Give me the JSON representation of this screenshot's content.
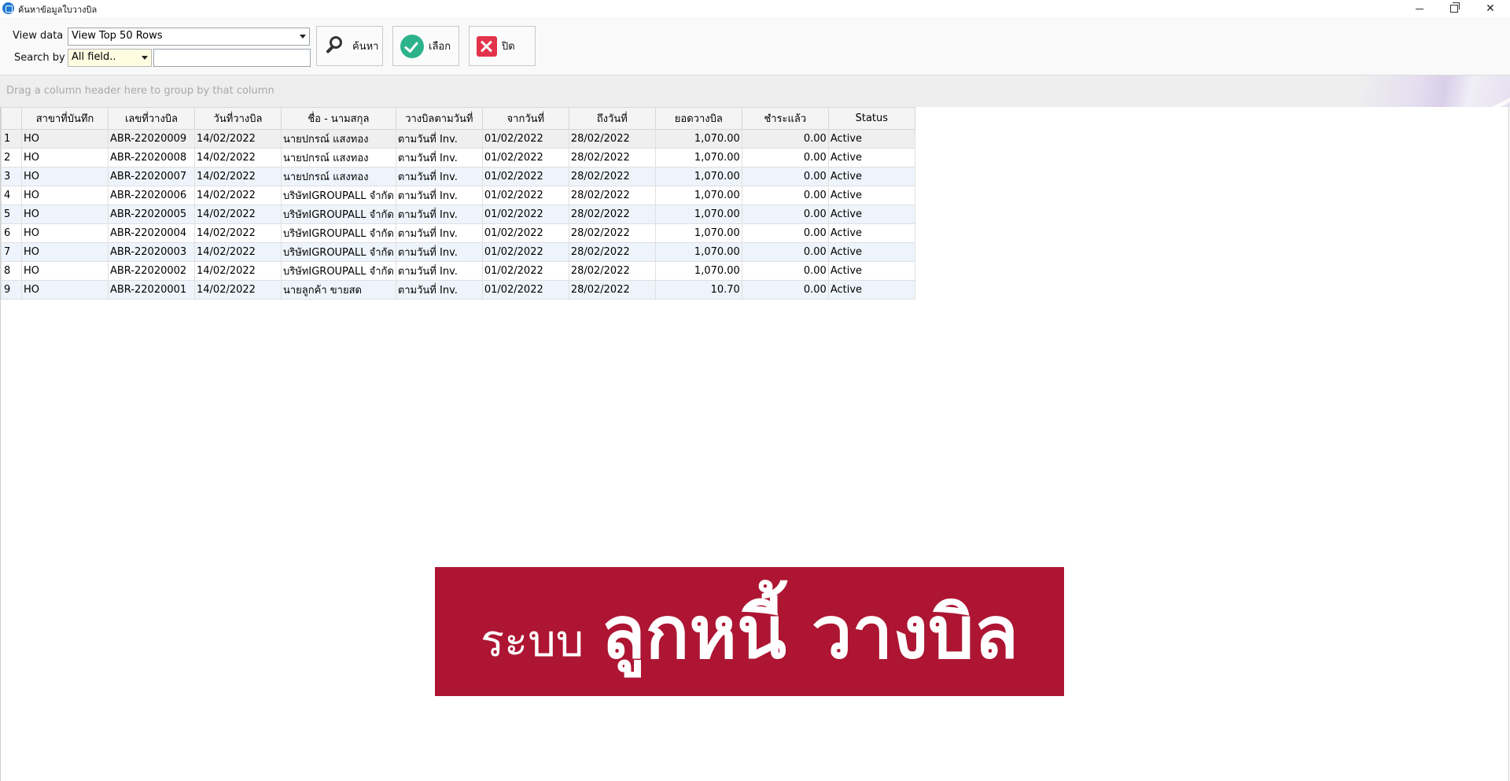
{
  "window": {
    "title": "ค้นหาข้อมูลใบวางบิล"
  },
  "toolbar": {
    "view_label": "View data",
    "view_value": "View Top 50 Rows",
    "search_label": "Search by",
    "search_field_value": "All field..",
    "search_text": "",
    "find_label": "ค้นหา",
    "select_label": "เลือก",
    "close_label": "ปิด"
  },
  "group_panel": {
    "hint": "Drag a column header here to group by that column"
  },
  "grid": {
    "columns": [
      "",
      "สาขาที่บันทึก",
      "เลขที่วางบิล",
      "วันที่วางบิล",
      "ชื่อ - นามสกุล",
      "วางบิลตามวันที่",
      "จากวันที่",
      "ถึงวันที่",
      "ยอดวางบิล",
      "ชำระแล้ว",
      "Status"
    ],
    "rows": [
      [
        "1",
        "HO",
        "ABR-22020009",
        "14/02/2022",
        "นายปกรณ์ แสงทอง",
        "ตามวันที่ Inv.",
        "01/02/2022",
        "28/02/2022",
        "1,070.00",
        "0.00",
        "Active"
      ],
      [
        "2",
        "HO",
        "ABR-22020008",
        "14/02/2022",
        "นายปกรณ์ แสงทอง",
        "ตามวันที่ Inv.",
        "01/02/2022",
        "28/02/2022",
        "1,070.00",
        "0.00",
        "Active"
      ],
      [
        "3",
        "HO",
        "ABR-22020007",
        "14/02/2022",
        "นายปกรณ์ แสงทอง",
        "ตามวันที่ Inv.",
        "01/02/2022",
        "28/02/2022",
        "1,070.00",
        "0.00",
        "Active"
      ],
      [
        "4",
        "HO",
        "ABR-22020006",
        "14/02/2022",
        "บริษัทIGROUPALL จำกัด",
        "ตามวันที่ Inv.",
        "01/02/2022",
        "28/02/2022",
        "1,070.00",
        "0.00",
        "Active"
      ],
      [
        "5",
        "HO",
        "ABR-22020005",
        "14/02/2022",
        "บริษัทIGROUPALL จำกัด",
        "ตามวันที่ Inv.",
        "01/02/2022",
        "28/02/2022",
        "1,070.00",
        "0.00",
        "Active"
      ],
      [
        "6",
        "HO",
        "ABR-22020004",
        "14/02/2022",
        "บริษัทIGROUPALL จำกัด",
        "ตามวันที่ Inv.",
        "01/02/2022",
        "28/02/2022",
        "1,070.00",
        "0.00",
        "Active"
      ],
      [
        "7",
        "HO",
        "ABR-22020003",
        "14/02/2022",
        "บริษัทIGROUPALL จำกัด",
        "ตามวันที่ Inv.",
        "01/02/2022",
        "28/02/2022",
        "1,070.00",
        "0.00",
        "Active"
      ],
      [
        "8",
        "HO",
        "ABR-22020002",
        "14/02/2022",
        "บริษัทIGROUPALL จำกัด",
        "ตามวันที่ Inv.",
        "01/02/2022",
        "28/02/2022",
        "1,070.00",
        "0.00",
        "Active"
      ],
      [
        "9",
        "HO",
        "ABR-22020001",
        "14/02/2022",
        "นายลูกค้า ขายสด",
        "ตามวันที่ Inv.",
        "01/02/2022",
        "28/02/2022",
        "10.70",
        "0.00",
        "Active"
      ]
    ]
  },
  "banner": {
    "small": "ระบบ",
    "big": "ลูกหนี้ วางบิล",
    "color": "#ad1533"
  }
}
